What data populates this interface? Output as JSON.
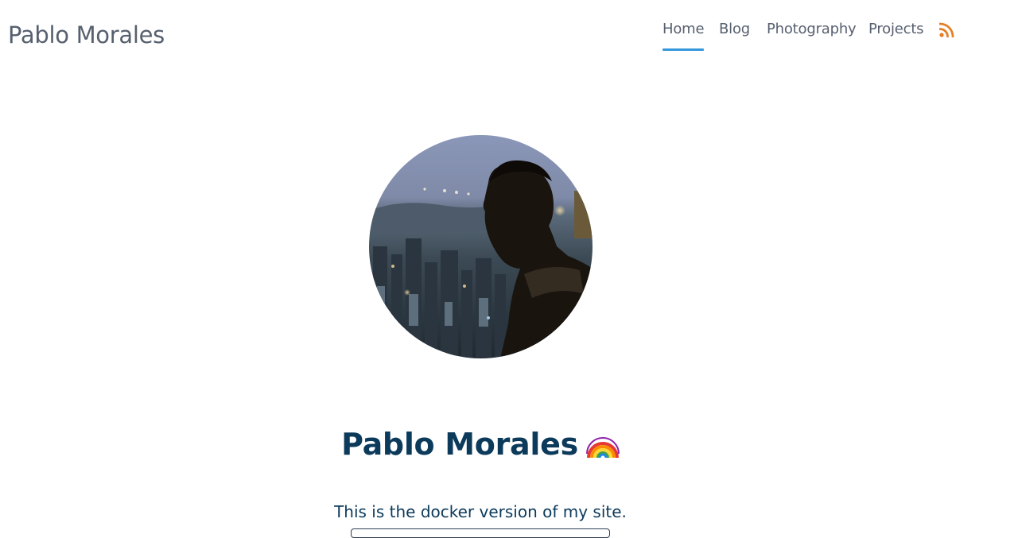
{
  "header": {
    "site_title": "Pablo Morales"
  },
  "nav": {
    "items": [
      {
        "label": "Home",
        "active": true
      },
      {
        "label": "Blog",
        "active": false
      },
      {
        "label": "Photography",
        "active": false
      },
      {
        "label": "Projects",
        "active": false
      }
    ],
    "rss_icon": "rss-icon",
    "accent_color": "#3498db",
    "rss_color": "#e67e22"
  },
  "profile": {
    "avatar_icon": "profile-photo",
    "name": "Pablo Morales",
    "emoji_icon": "rainbow-icon",
    "tagline": "This is the docker version of my site."
  }
}
